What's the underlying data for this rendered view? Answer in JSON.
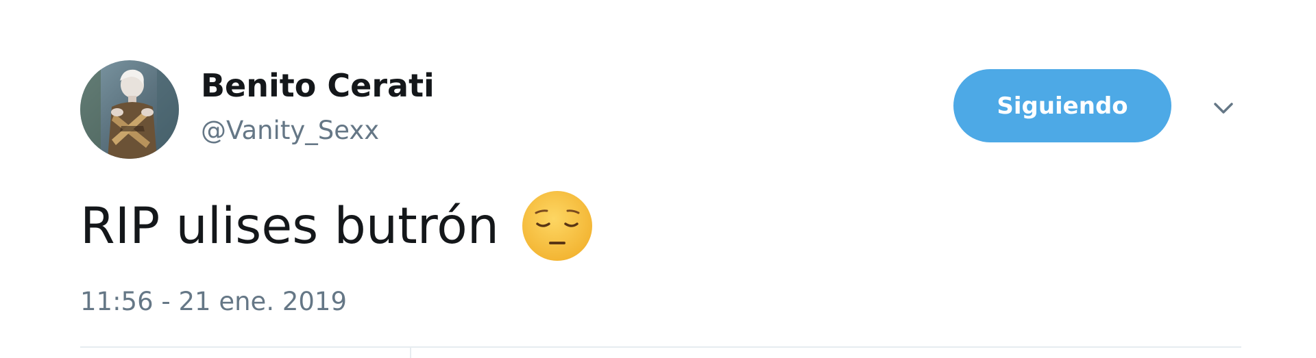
{
  "author": {
    "display_name": "Benito Cerati",
    "handle": "@Vanity_Sexx"
  },
  "follow_button": {
    "label": "Siguiendo",
    "color": "#4da9e6"
  },
  "menu": {
    "icon": "chevron-down-icon"
  },
  "tweet": {
    "text": "RIP ulises butrón",
    "emoji": "pensive-face-emoji",
    "timestamp": "11:56 - 21 ene. 2019"
  },
  "colors": {
    "text": "#14171a",
    "secondary": "#657786",
    "divider": "#e6ecf0"
  }
}
